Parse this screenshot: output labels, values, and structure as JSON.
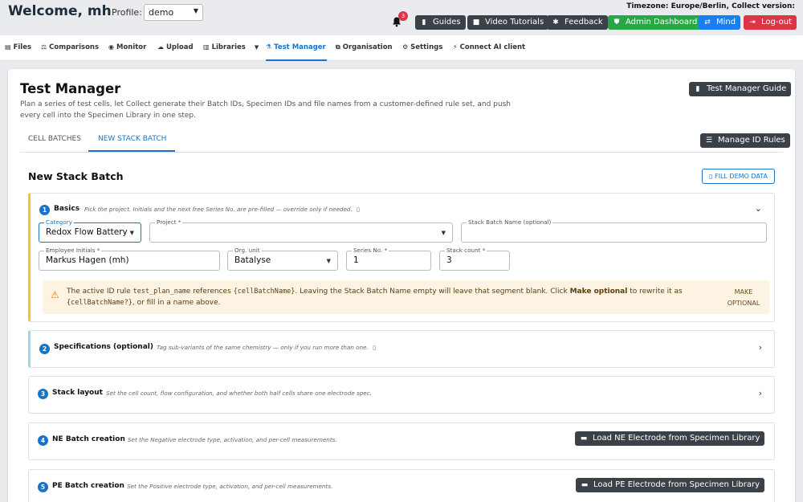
{
  "header": {
    "welcome": "Welcome, mh",
    "profile_label": "Profile:",
    "profile_value": "demo",
    "timezone": "Timezone: Europe/Berlin, Collect version:",
    "notification_count": "3",
    "buttons": {
      "guides": "Guides",
      "video_tutorials": "Video Tutorials",
      "feedback": "Feedback",
      "admin_dashboard": "Admin Dashboard",
      "mind": "Mind",
      "logout": "Log-out"
    },
    "colors": {
      "dark": "#3b4148",
      "green": "#28a745",
      "blue": "#1a7ef0",
      "red": "#dc3545"
    }
  },
  "nav": {
    "files": "Files",
    "comparisons": "Comparisons",
    "monitor": "Monitor",
    "upload": "Upload",
    "libraries": "Libraries",
    "test_manager": "Test Manager",
    "organisation": "Organisation",
    "settings": "Settings",
    "connect_ai": "Connect AI client"
  },
  "page": {
    "title": "Test Manager",
    "description": "Plan a series of test cells, let Collect generate their Batch IDs, Specimen IDs and file names from a customer-defined rule set, and push every cell into the Specimen Library in one step.",
    "guide_button": "Test Manager Guide",
    "tabs": {
      "cell_batches": "CELL BATCHES",
      "new_stack_batch": "NEW STACK BATCH"
    },
    "manage_id_rules": "Manage ID Rules",
    "form_title": "New Stack Batch",
    "fill_demo": "FILL DEMO DATA"
  },
  "sections": {
    "basics": {
      "number": "1",
      "title": "Basics",
      "hint": "Pick the project. Initials and the next free Series No. are pre-filled — override only if needed.",
      "fields": {
        "category_label": "Category",
        "category_value": "Redox Flow Battery",
        "project_label": "Project *",
        "project_value": "",
        "stack_name_label": "Stack Batch Name (optional)",
        "stack_name_value": "",
        "initials_label": "Employee Initials *",
        "initials_value": "Markus Hagen (mh)",
        "org_label": "Org. unit",
        "org_value": "Batalyse",
        "series_label": "Series No. *",
        "series_value": "1",
        "count_label": "Stack count *",
        "count_value": "3"
      },
      "alert": {
        "p1": "The active ID rule ",
        "code1": "test_plan_name",
        "p2": " references ",
        "code2": "{cellBatchName}",
        "p3": ". Leaving the Stack Batch Name empty will leave that segment blank. Click ",
        "bold": "Make optional",
        "p4": " to rewrite it as ",
        "code3": "{cellBatchName?}",
        "p5": ", or fill in a name above.",
        "action": "MAKE OPTIONAL"
      }
    },
    "specs": {
      "number": "2",
      "title": "Specifications (optional)",
      "hint": "Tag sub-variants of the same chemistry — only if you run more than one."
    },
    "stack": {
      "number": "3",
      "title": "Stack layout",
      "hint": "Set the cell count, flow configuration, and whether both half cells share one electrode spec."
    },
    "ne": {
      "number": "4",
      "title": "NE Batch creation",
      "hint": "Set the Negative electrode type, activation, and per-cell measurements.",
      "button": "Load NE Electrode from Specimen Library"
    },
    "pe": {
      "number": "5",
      "title": "PE Batch creation",
      "hint": "Set the Positive electrode type, activation, and per-cell measurements.",
      "button": "Load PE Electrode from Specimen Library"
    }
  }
}
